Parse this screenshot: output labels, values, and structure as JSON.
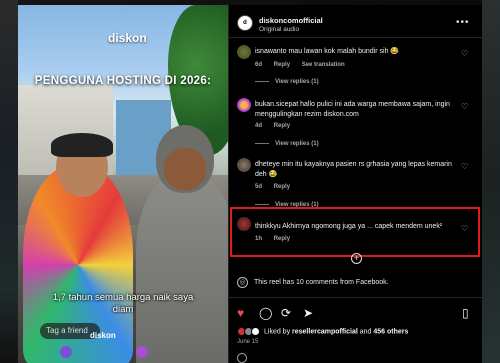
{
  "media": {
    "brand": "diskon",
    "headline": "PENGGUNA HOSTING DI 2026:",
    "caption": "1,7 tahun semua harga naik saya diam",
    "tag_button": "Tag a friend",
    "watermark": "diskon"
  },
  "header": {
    "username": "diskoncomofficial",
    "audio": "Original audio",
    "more": "•••"
  },
  "comments": [
    {
      "text": "isnawanto mau lawan kok malah bundir sih 😂",
      "age": "6d",
      "reply": "Reply",
      "translate": "See translation",
      "view_replies": "View replies (1)"
    },
    {
      "text": "bukan.sicepat hallo pulici ini ada warga membawa sajam, ingin menggulingkan rezim diskon.com",
      "age": "4d",
      "reply": "Reply",
      "view_replies": "View replies (1)"
    },
    {
      "text": "dheteye min itu kayaknya pasien rs grhasia yang lepas kemarin deh 😂",
      "age": "5d",
      "reply": "Reply",
      "view_replies": "View replies (1)"
    },
    {
      "text": "thinkkyu Akhirnya ngomong juga ya ... capek mendem unek²",
      "age": "1h",
      "reply": "Reply"
    }
  ],
  "facebook_note": "This reel has 10 comments from Facebook.",
  "likes": {
    "prefix": "Liked by ",
    "user": "resellercampofficial",
    "middle": " and ",
    "others": "456 others"
  },
  "date": "June 15",
  "colors": {
    "highlight": "#e01b1b",
    "like": "#ed4956"
  },
  "icons": [
    "heart-icon",
    "comment-icon",
    "repost-icon",
    "share-icon",
    "bookmark-icon",
    "globe-icon",
    "plus-circle-icon"
  ]
}
